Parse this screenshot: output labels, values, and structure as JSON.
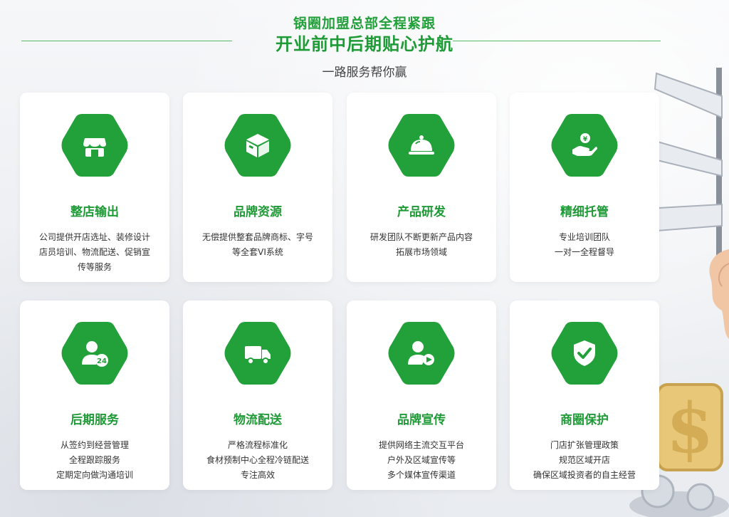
{
  "header": {
    "title_line1": "锅圈加盟总部全程紧跟",
    "title_line2": "开业前中后期贴心护航",
    "subtitle": "一路服务帮你赢"
  },
  "colors": {
    "brand_green": "#22a03a",
    "card_bg": "#ffffff"
  },
  "cards": [
    {
      "icon": "storefront-icon",
      "title": "整店输出",
      "lines": [
        "公司提供开店选址、装修设计",
        "店员培训、物流配送、促销宣",
        "传等服务"
      ]
    },
    {
      "icon": "box-icon",
      "title": "品牌资源",
      "lines": [
        "无偿提供整套品牌商标、字号",
        "等全套VI系统"
      ]
    },
    {
      "icon": "cloche-icon",
      "title": "产品研发",
      "lines": [
        "研发团队不断更新产品内容",
        "拓展市场领域"
      ]
    },
    {
      "icon": "hand-coin-icon",
      "title": "精细托管",
      "lines": [
        "专业培训团队",
        "一对一全程督导"
      ]
    },
    {
      "icon": "user-24-icon",
      "title": "后期服务",
      "lines": [
        "从签约到经营管理",
        "全程跟踪服务",
        "定期定向做沟通培训"
      ]
    },
    {
      "icon": "truck-icon",
      "title": "物流配送",
      "lines": [
        "严格流程标准化",
        "食材预制中心全程冷链配送",
        "专注高效"
      ]
    },
    {
      "icon": "user-play-icon",
      "title": "品牌宣传",
      "lines": [
        "提供网络主流交互平台",
        "户外及区域宣传等",
        "多个媒体宣传渠道"
      ]
    },
    {
      "icon": "shield-check-icon",
      "title": "商圈保护",
      "lines": [
        "门店扩张管理政策",
        "规范区域开店",
        "确保区域投资者的自主经营"
      ]
    }
  ]
}
